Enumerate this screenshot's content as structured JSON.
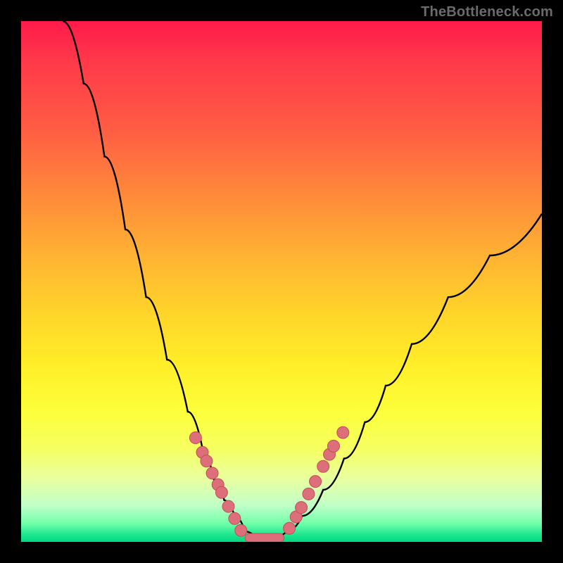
{
  "watermark": {
    "text": "TheBottleneck.com"
  },
  "chart_data": {
    "type": "line",
    "title": "",
    "xlabel": "",
    "ylabel": "",
    "xlim": [
      0,
      100
    ],
    "ylim": [
      0,
      100
    ],
    "curve": {
      "name": "bottleneck-curve",
      "x": [
        8,
        12,
        16,
        20,
        24,
        28,
        32,
        35,
        37,
        39,
        41,
        43,
        45,
        47,
        49,
        51,
        54,
        58,
        62,
        66,
        70,
        75,
        82,
        90,
        100
      ],
      "y": [
        100,
        88,
        74,
        60,
        47,
        35,
        25,
        17,
        12,
        8,
        5,
        2,
        1,
        1,
        1,
        2,
        5,
        10,
        16,
        23,
        30,
        38,
        47,
        55,
        63
      ]
    },
    "markers_left": {
      "name": "left-markers",
      "color": "#dd6f7a",
      "x": [
        33.5,
        34.8,
        35.6,
        36.7,
        37.8,
        38.5,
        39.8,
        41.0,
        42.2
      ],
      "y": [
        20.0,
        17.2,
        15.5,
        13.2,
        11.0,
        9.5,
        6.8,
        4.5,
        2.2
      ]
    },
    "markers_right": {
      "name": "right-markers",
      "color": "#dd6f7a",
      "x": [
        51.5,
        52.8,
        53.8,
        55.2,
        56.5,
        58.0,
        59.2,
        60.0,
        61.8
      ],
      "y": [
        2.6,
        4.8,
        6.6,
        9.2,
        11.6,
        14.5,
        16.8,
        18.4,
        21.0
      ]
    },
    "valley_bar": {
      "name": "valley-bar",
      "color": "#dd6f7a",
      "x": [
        43.0,
        50.5
      ],
      "y": 0.8,
      "thickness": 12
    },
    "colors": {
      "curve": "#000000",
      "marker_fill": "#dd6f7a",
      "marker_stroke": "#c24f5a"
    }
  }
}
